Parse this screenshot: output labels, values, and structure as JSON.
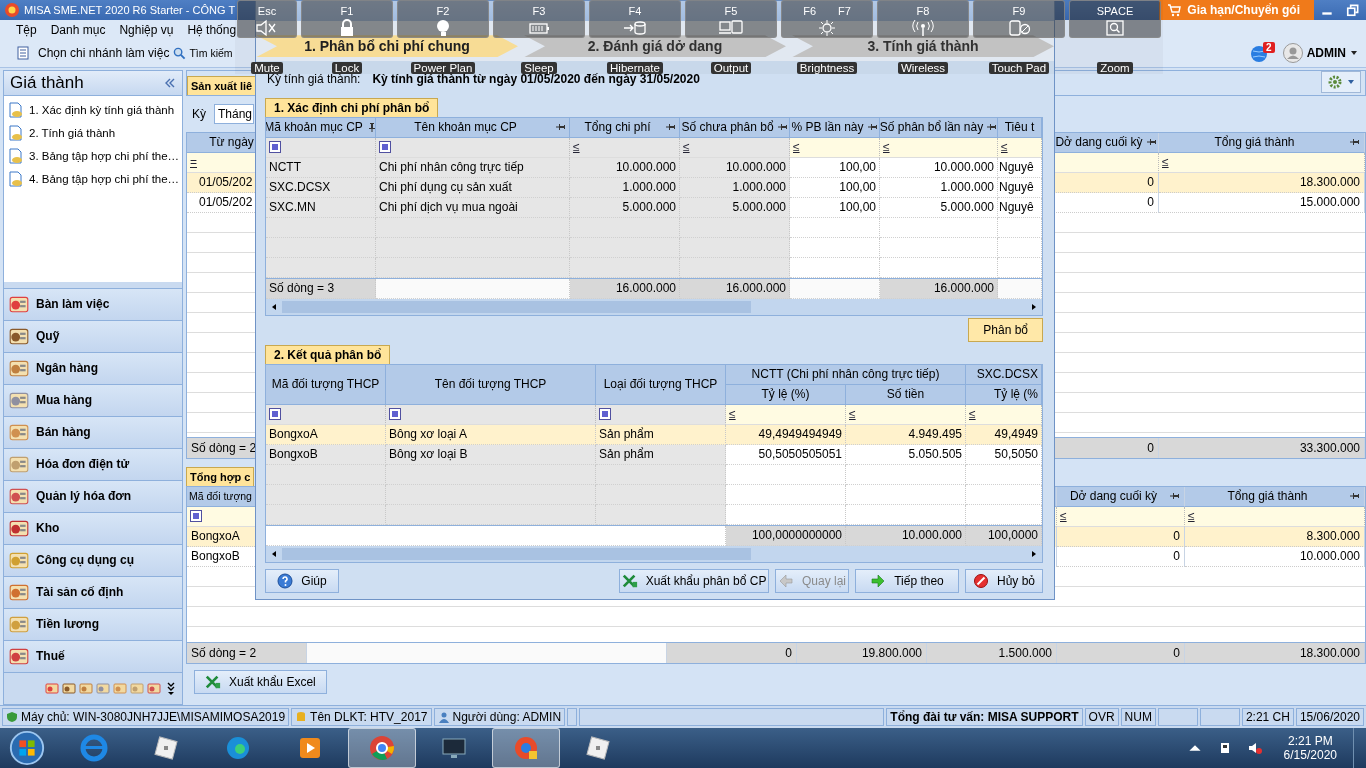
{
  "app": {
    "title": "MISA SME.NET 2020 R6 Starter - CÔNG T",
    "upgrade_button": "Gia hạn/Chuyển gói",
    "notification_count": "2",
    "user": "ADMIN"
  },
  "menu": [
    "Tệp",
    "Danh mục",
    "Nghiệp vụ",
    "Hệ thống"
  ],
  "toolbar": {
    "branch_button": "Chọn chi nhánh làm việc",
    "search": {
      "placeholder": "Tìm kiếm"
    }
  },
  "sidebar": {
    "title": "Giá thành",
    "items": [
      "1. Xác định kỳ tính giá thành",
      "2. Tính giá thành",
      "3. Bảng tập hợp chi phí the…",
      "4. Bảng tập hợp chi phí the…"
    ],
    "modules": [
      "Bàn làm việc",
      "Quỹ",
      "Ngân hàng",
      "Mua hàng",
      "Bán hàng",
      "Hóa đơn điện tử",
      "Quản lý hóa đơn",
      "Kho",
      "Công cụ dụng cụ",
      "Tài sản cố định",
      "Tiền lương",
      "Thuế"
    ]
  },
  "main": {
    "tab": "Sản xuất liê",
    "period_label": "Kỳ",
    "period_value": "Tháng",
    "top_grid": {
      "columns": [
        {
          "header": "Từ ngày",
          "kind": "date",
          "filter": {
            "kind": "op",
            "text": "="
          }
        },
        {
          "header": "Dở dang cuối kỳ",
          "kind": "number",
          "pinned": false
        },
        {
          "header": "Tổng giá thành",
          "kind": "number",
          "pinned": false,
          "filter": {
            "kind": "op",
            "text": "≤"
          }
        }
      ],
      "rows": [
        {
          "selected": true,
          "cells": [
            "01/05/202",
            "0",
            "18.300.000"
          ]
        },
        {
          "selected": false,
          "cells": [
            "01/05/202",
            "0",
            "15.000.000"
          ]
        }
      ],
      "footer": {
        "row_count": "Số dòng = 2",
        "totals": [
          "0",
          "33.300.000"
        ]
      }
    },
    "summary_tab": "Tổng hợp c",
    "bottom_grid": {
      "columns": [
        {
          "header": "Mã đối tượng",
          "kind": "text",
          "filter": {
            "kind": "box"
          }
        },
        {
          "header": "Dở dang cuối kỳ",
          "kind": "number",
          "pinned": false,
          "filter": {
            "kind": "op",
            "text": "≤"
          }
        },
        {
          "header": "Tổng giá thành",
          "kind": "number",
          "pinned": false,
          "filter": {
            "kind": "op",
            "text": "≤"
          }
        }
      ],
      "rows": [
        {
          "selected": true,
          "cells": [
            "BongxoA",
            "0",
            "8.300.000"
          ]
        },
        {
          "selected": false,
          "cells": [
            "BongxoB",
            "0",
            "10.000.000"
          ]
        }
      ],
      "footer": {
        "row_count": "Số dòng = 2",
        "totals": [
          "0",
          "19.800.000",
          "1.500.000",
          "0",
          "18.300.000"
        ]
      }
    },
    "export_button": "Xuất khẩu Excel"
  },
  "dialog": {
    "steps": [
      {
        "label": "1. Phân bổ chi phí chung",
        "selected": true
      },
      {
        "label": "2. Đánh giá dở dang",
        "selected": false
      },
      {
        "label": "3. Tính giá thành",
        "selected": false
      }
    ],
    "period_label": "Kỳ tính giá thành:",
    "period_value": "Kỳ tính giá thành từ ngày 01/05/2020 đến ngày 31/05/2020",
    "section1": {
      "title": "1. Xác định chi phí phân bổ",
      "columns": [
        {
          "header": "Mã khoản mục CP",
          "kind": "text",
          "pinned": true,
          "filter": {
            "kind": "box"
          },
          "editable": false
        },
        {
          "header": "Tên khoản mục CP",
          "kind": "text",
          "pinned": false,
          "filter": {
            "kind": "box"
          },
          "editable": false,
          "total": false
        },
        {
          "header": "Tổng chi phí",
          "kind": "number",
          "pinned": false,
          "filter": {
            "kind": "op",
            "text": "≤"
          },
          "editable": false,
          "total": true
        },
        {
          "header": "Số chưa phân bổ",
          "kind": "number",
          "pinned": false,
          "filter": {
            "kind": "op",
            "text": "≤"
          },
          "editable": false,
          "total": true
        },
        {
          "header": "% PB lần này",
          "kind": "number",
          "pinned": false,
          "filter": {
            "kind": "op",
            "text": "≤"
          },
          "editable": true,
          "total": false
        },
        {
          "header": "Số phân bổ lần này",
          "kind": "number",
          "pinned": false,
          "filter": {
            "kind": "op",
            "text": "≤"
          },
          "editable": true,
          "total": true
        },
        {
          "header": "Tiêu t",
          "kind": "text",
          "filter": {
            "kind": "op",
            "text": "≤"
          },
          "editable": true,
          "total": false
        }
      ],
      "rows": [
        {
          "cells": [
            "NCTT",
            "Chi phí nhân công trực tiếp",
            "10.000.000",
            "10.000.000",
            "100,00",
            "10.000.000",
            "Nguyê"
          ]
        },
        {
          "cells": [
            "SXC.DCSX",
            "Chi phí dụng cụ sản xuất",
            "1.000.000",
            "1.000.000",
            "100,00",
            "1.000.000",
            "Nguyê"
          ]
        },
        {
          "cells": [
            "SXC.MN",
            "Chi phí dịch vụ mua ngoài",
            "5.000.000",
            "5.000.000",
            "100,00",
            "5.000.000",
            "Nguyê"
          ]
        }
      ],
      "footer": {
        "row_count": "Số dòng = 3",
        "totals": [
          "16.000.000",
          "16.000.000",
          "16.000.000"
        ]
      }
    },
    "allocate_button": "Phân bổ",
    "section2": {
      "title": "2. Kết quả phân bổ",
      "columns": [
        {
          "header": "Mã đối tượng THCP",
          "kind": "text",
          "filter": {
            "kind": "box"
          },
          "editable": false
        },
        {
          "header": "Tên đối tượng THCP",
          "kind": "text",
          "filter": {
            "kind": "box"
          },
          "editable": false
        },
        {
          "header": "Loại đối tượng THCP",
          "kind": "text",
          "filter": {
            "kind": "box"
          },
          "editable": false
        }
      ],
      "groups": [
        {
          "title": "NCTT (Chi phí nhân công trực tiếp)",
          "columns": [
            {
              "header": "Tỷ lệ (%)",
              "kind": "number",
              "filter": {
                "kind": "op",
                "text": "≤"
              },
              "editable": true
            },
            {
              "header": "Số tiền",
              "kind": "number",
              "filter": {
                "kind": "op",
                "text": "≤"
              },
              "editable": true
            }
          ]
        },
        {
          "title": "SXC.DCSX",
          "columns": [
            {
              "header": "Tỷ lệ (%",
              "kind": "number",
              "filter": {
                "kind": "op",
                "text": "≤"
              },
              "editable": true
            }
          ]
        }
      ],
      "rows": [
        {
          "selected": true,
          "cells": [
            "BongxoA",
            "Bông xơ loại A",
            "Sản phẩm",
            "49,4949494949",
            "4.949.495",
            "49,4949"
          ]
        },
        {
          "selected": false,
          "cells": [
            "BongxoB",
            "Bông xơ loại B",
            "Sản phẩm",
            "50,5050505051",
            "5.050.505",
            "50,5050"
          ]
        }
      ],
      "footer": {
        "totals": [
          "100,0000000000",
          "10.000.000",
          "100,0000"
        ]
      }
    },
    "buttons": [
      {
        "kind": "help",
        "label": "Giúp",
        "disabled": false
      },
      {
        "kind": "export",
        "label": "Xuất khẩu phân bổ CP",
        "disabled": false
      },
      {
        "kind": "back",
        "label": "Quay lại",
        "disabled": true
      },
      {
        "kind": "next",
        "label": "Tiếp theo",
        "disabled": false
      },
      {
        "kind": "cancel",
        "label": "Hủy bỏ",
        "disabled": false
      }
    ]
  },
  "status_bar": {
    "server": "Máy chủ: WIN-3080JNH7JJE\\MISAMIMOSA2019",
    "database": "Tên DLKT: HTV_2017",
    "user": "Người dùng: ADMIN",
    "support": "Tổng đài tư vấn: MISA SUPPORT",
    "indicators": [
      "OVR",
      "NUM"
    ],
    "time": "2:21 CH",
    "date": "15/06/2020"
  },
  "taskbar": {
    "apps": [
      {
        "active": false
      },
      {
        "active": false
      },
      {
        "active": false
      },
      {
        "active": false
      },
      {
        "active": true
      },
      {
        "active": false
      },
      {
        "active": true
      },
      {
        "active": false
      }
    ],
    "time": "2:21 PM",
    "date": "6/15/2020"
  },
  "osd": {
    "keys": [
      {
        "keys": [
          "Esc"
        ],
        "label": "Mute"
      },
      {
        "keys": [
          "F1"
        ],
        "label": "Lock"
      },
      {
        "keys": [
          "F2"
        ],
        "label": "Power Plan"
      },
      {
        "keys": [
          "F3"
        ],
        "label": "Sleep"
      },
      {
        "keys": [
          "F4"
        ],
        "label": "Hibernate"
      },
      {
        "keys": [
          "F5"
        ],
        "label": "Output"
      },
      {
        "keys": [
          "F6",
          "F7"
        ],
        "label": "Brightness"
      },
      {
        "keys": [
          "F8"
        ],
        "label": "Wireless"
      },
      {
        "keys": [
          "F9"
        ],
        "label": "Touch Pad"
      },
      {
        "keys": [
          "SPACE"
        ],
        "label": "Zoom"
      }
    ]
  }
}
